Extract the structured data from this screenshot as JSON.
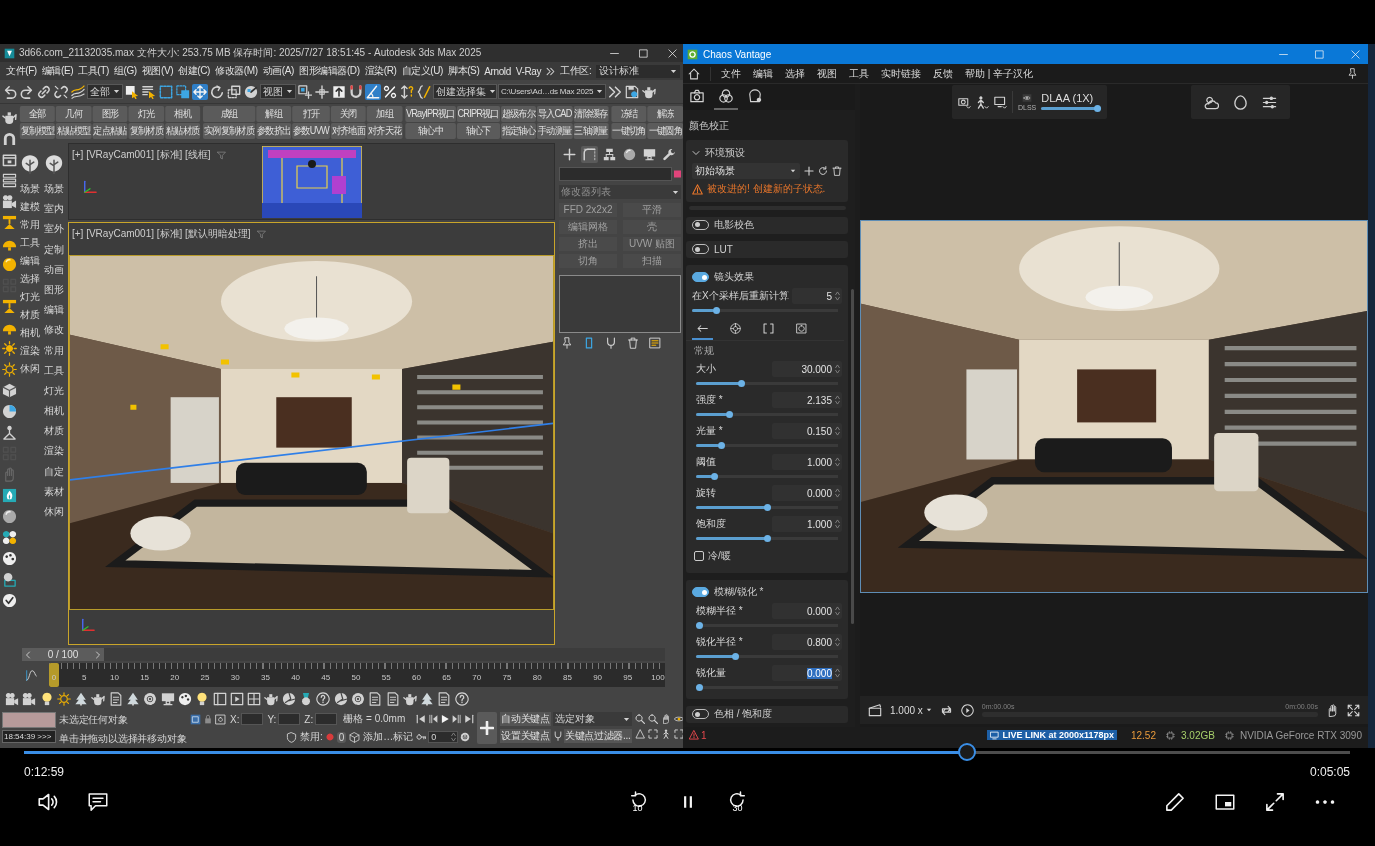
{
  "max_window": {
    "title": "3d66.com_21132035.max 文件大小: 253.75 MB 保存时间: 2025/7/27 18:51:45 - Autodesk 3ds Max 2025",
    "menu": [
      "文件(F)",
      "编辑(E)",
      "工具(T)",
      "组(G)",
      "视图(V)",
      "创建(C)",
      "修改器(M)",
      "动画(A)",
      "图形编辑器(D)",
      "渲染(R)",
      "自定义(U)",
      "脚本(S)",
      "Arnold",
      "V-Ray"
    ],
    "workspace": {
      "label": "工作区:",
      "value": "设计标准"
    },
    "toolbar": [
      {
        "kind": "tool",
        "selected": false
      },
      {
        "kind": "tool",
        "selected": false
      },
      {
        "kind": "tool",
        "selected": false
      },
      {
        "kind": "tool",
        "selected": false
      },
      {
        "kind": "tool",
        "selected": false
      },
      {
        "kind": "dropdown",
        "value": "全部"
      },
      {
        "kind": "tool",
        "selected": false
      },
      {
        "kind": "tool",
        "selected": false
      },
      {
        "kind": "tool",
        "selected": false
      },
      {
        "kind": "tool",
        "selected": false
      },
      {
        "kind": "tool",
        "selected": true
      },
      {
        "kind": "tool",
        "selected": false
      },
      {
        "kind": "tool",
        "selected": false
      },
      {
        "kind": "tool",
        "selected": false
      },
      {
        "kind": "dropdown",
        "value": "视图"
      },
      {
        "kind": "tool",
        "selected": false
      },
      {
        "kind": "tool",
        "selected": false
      },
      {
        "kind": "tool",
        "selected": false
      },
      {
        "kind": "tool",
        "selected": false
      },
      {
        "kind": "tool",
        "selected": true
      },
      {
        "kind": "tool",
        "selected": false
      },
      {
        "kind": "tool",
        "selected": false
      },
      {
        "kind": "tool",
        "selected": false
      },
      {
        "kind": "dropdown",
        "value": "创建选择集"
      },
      {
        "kind": "dropdown",
        "value": "C:\\Users\\Ad…ds Max 2025"
      },
      {
        "kind": "tool",
        "selected": false
      },
      {
        "kind": "tool",
        "selected": false
      },
      {
        "kind": "tool",
        "selected": false
      }
    ],
    "left_toolbar": [
      {
        "disabled": false
      },
      {
        "disabled": false
      },
      {
        "disabled": false
      },
      {
        "disabled": false
      },
      {
        "disabled": false
      },
      {
        "disabled": false
      },
      {
        "disabled": false
      },
      {
        "disabled": false
      },
      {
        "disabled": true
      },
      {
        "disabled": false
      },
      {
        "disabled": false
      },
      {
        "disabled": false
      },
      {
        "disabled": false
      },
      {
        "disabled": false
      },
      {
        "disabled": false
      },
      {
        "disabled": false
      },
      {
        "disabled": true
      },
      {
        "disabled": true
      },
      {
        "disabled": false
      },
      {
        "disabled": false
      },
      {
        "disabled": false
      },
      {
        "disabled": false
      },
      {
        "disabled": false
      },
      {
        "disabled": false
      }
    ],
    "quick_buttons": [
      [
        "全部",
        "几何",
        "图形",
        "灯光",
        "相机",
        "复制模型",
        "粘贴模型",
        "定点粘贴",
        "复制材质",
        "粘贴材质"
      ],
      [
        "成组",
        "解组",
        "打开",
        "关闭",
        "加组",
        "实例复制材质",
        "参数挤出",
        "参数UVW",
        "对齐地面",
        "对齐天花"
      ],
      [
        "VRayIPR视口",
        "CRIPR视口",
        "超级布尔",
        "导入CAD",
        "清除缓存",
        "轴心中",
        "轴心下",
        "指定轴心",
        "手动测量",
        "三轴测量"
      ],
      [
        "冻结",
        "解冻",
        "一键切角",
        "一键圆角"
      ]
    ],
    "category_columns": [
      [
        "场景",
        "建模",
        "常用",
        "工具",
        "编辑",
        "选择",
        "灯光",
        "材质",
        "相机",
        "渲染",
        "休闲"
      ],
      [
        "场景",
        "室内",
        "室外",
        "定制",
        "动画",
        "图形",
        "编辑",
        "修改",
        "常用",
        "工具",
        "灯光",
        "相机",
        "材质",
        "渲染",
        "自定",
        "素材",
        "休闲"
      ]
    ],
    "viewports": [
      {
        "label": "[+] [VRayCam001] [标准] [线框]",
        "kind": "thumbnail",
        "active": false
      },
      {
        "label": "[+] [VRayCam001] [标准] [默认明暗处理]",
        "kind": "render",
        "active": true
      }
    ],
    "command_panel": {
      "tabs": [
        {
          "selected": false
        },
        {
          "selected": true
        },
        {
          "selected": false
        },
        {
          "selected": false
        },
        {
          "selected": false
        },
        {
          "selected": false
        }
      ],
      "modifier_list": "修改器列表",
      "modifier_buttons": [
        {
          "label": "FFD 2x2x2",
          "disabled": true
        },
        {
          "label": "平滑",
          "disabled": true
        },
        {
          "label": "编辑网格",
          "disabled": true
        },
        {
          "label": "壳",
          "disabled": true
        },
        {
          "label": "挤出",
          "disabled": true
        },
        {
          "label": "UVW 贴图",
          "disabled": true
        },
        {
          "label": "切角",
          "disabled": true
        },
        {
          "label": "扫描",
          "disabled": true
        }
      ]
    },
    "timeline": {
      "position": "0 / 100",
      "level": 0,
      "ticks": [
        "0",
        "5",
        "10",
        "15",
        "20",
        "25",
        "30",
        "35",
        "40",
        "45",
        "50",
        "55",
        "60",
        "65",
        "70",
        "75",
        "80",
        "85",
        "90",
        "95",
        "100"
      ]
    },
    "status": {
      "listener": "18:54:39 >>>",
      "prompt": "未选定任何对象",
      "hint": "单击并拖动以选择并移动对象",
      "coords": [
        "X:",
        "Y:",
        "Z:"
      ],
      "grid": "栅格 = 0.0mm",
      "disable_label": "禁用:",
      "disable_count": "0",
      "add_marker": "添加…标记",
      "frame": "0",
      "auto_key": "自动关键点",
      "key_target": "选定对象",
      "set_key": "设置关键点",
      "key_filters": "关键点过滤器..."
    }
  },
  "vantage_window": {
    "title": "Chaos Vantage",
    "menu": [
      "文件",
      "编辑",
      "选择",
      "视图",
      "工具",
      "实时链接",
      "反馈",
      "帮助 | 辛子汉化"
    ],
    "panel_tabs": [
      {
        "selected": false
      },
      {
        "selected": true
      },
      {
        "selected": false
      }
    ],
    "panel_heading": "颜色校正",
    "preset_section": {
      "title": "环境预设",
      "expanded": true,
      "preset": "初始场景",
      "warning": "被改进的! 创建新的子状态."
    },
    "sections": [
      {
        "title": "电影校色",
        "on": false
      },
      {
        "title": "LUT",
        "on": false
      },
      {
        "title": "镜头效果",
        "on": true,
        "recalc": {
          "label": "在X个采样后重新计算",
          "value": "5",
          "level": 0.15,
          "value_selected": false
        },
        "tabs": [
          {
            "selected": true
          },
          {
            "selected": false
          },
          {
            "selected": false
          },
          {
            "selected": false
          }
        ],
        "subheading": "常规",
        "params": [
          {
            "label": "大小",
            "value": "30.000",
            "level": 0.31,
            "value_selected": false
          },
          {
            "label": "强度 *",
            "value": "2.135",
            "level": 0.22,
            "value_selected": false
          },
          {
            "label": "光量 *",
            "value": "0.150",
            "level": 0.16,
            "value_selected": false
          },
          {
            "label": "阈值",
            "value": "1.000",
            "level": 0.11,
            "value_selected": false
          },
          {
            "label": "旋转",
            "value": "0.000",
            "level": 0.5,
            "value_selected": false
          },
          {
            "label": "饱和度",
            "value": "1.000",
            "level": 0.5,
            "value_selected": false
          }
        ],
        "checkbox": {
          "label": "冷/暖",
          "checked": false
        }
      },
      {
        "title": "模糊/锐化 *",
        "on": true,
        "params": [
          {
            "label": "模糊半径 *",
            "value": "0.000",
            "level": 0,
            "value_selected": false
          },
          {
            "label": "锐化半径 *",
            "value": "0.800",
            "level": 0.27,
            "value_selected": false
          },
          {
            "label": "锐化量",
            "value": "0.000",
            "level": 0,
            "value_selected": true
          }
        ]
      },
      {
        "title": "色相 / 饱和度",
        "on": false
      }
    ],
    "viewport_toolbar": {
      "upscaler": "DLSS",
      "mode": "DLAA (1X)",
      "level": 1
    },
    "timeline": {
      "speed": "1.000 x",
      "start": "0m:00.00s",
      "end": "0m:00.00s"
    },
    "status": {
      "warnings": "1",
      "live_link": "LIVE LINK at 2000x1178px",
      "fps": "12.52",
      "memory": "3.02GB",
      "gpu": "NVIDIA GeForce RTX 3090"
    }
  },
  "player": {
    "progress": {
      "level": 0.714
    },
    "elapsed": "0:12:59",
    "remaining": "0:05:05",
    "playing": true,
    "rewind_seconds": "10",
    "forward_seconds": "30"
  }
}
